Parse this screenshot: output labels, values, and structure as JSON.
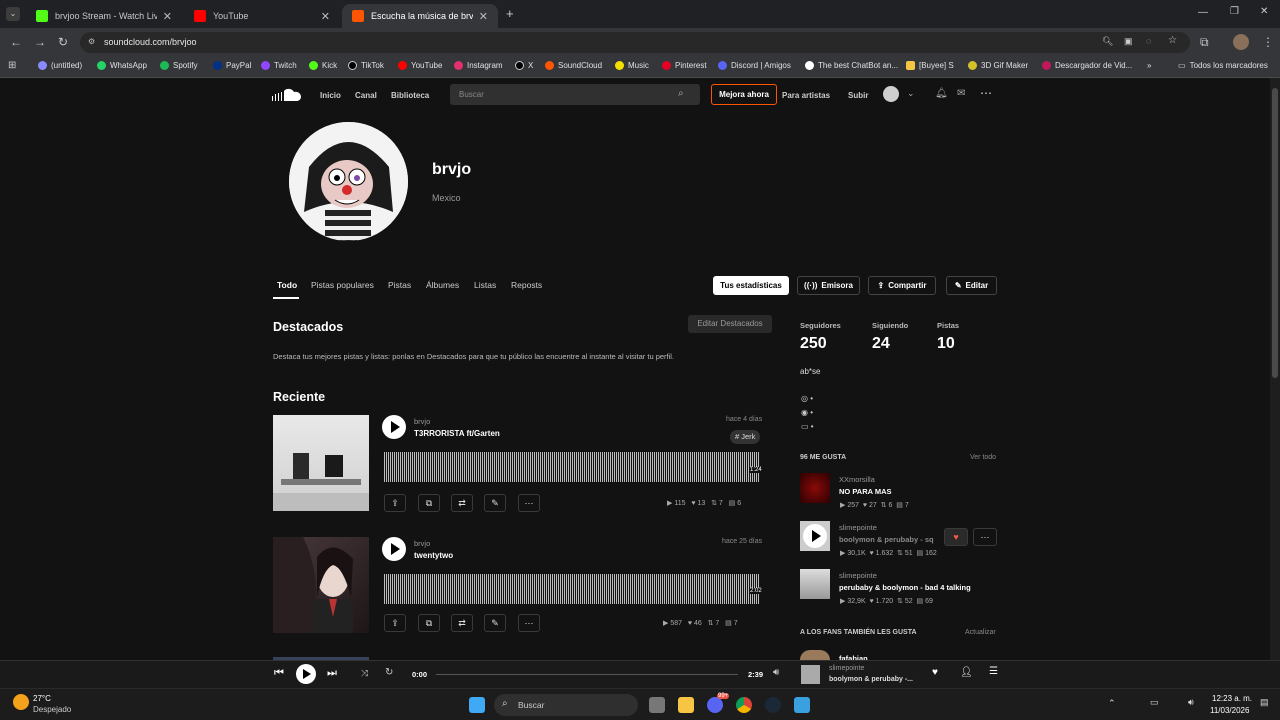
{
  "browser": {
    "tabs": [
      {
        "label": "brvjoo Stream - Watch Live on K"
      },
      {
        "label": "YouTube"
      },
      {
        "label": "Escucha la música de brvjo | Di"
      }
    ],
    "new_tab": "+",
    "url": "soundcloud.com/brvjoo",
    "bookmarks": [
      "(untitled)",
      "WhatsApp",
      "Spotify",
      "PayPal",
      "Twitch",
      "Kick",
      "TikTok",
      "YouTube",
      "Instagram",
      "X",
      "SoundCloud",
      "Music",
      "Pinterest",
      "Discord | Amigos",
      "The best ChatBot an...",
      "[Buyee] S",
      "3D Gif Maker",
      "Descargador de Vid..."
    ],
    "bookmarks_more": "»",
    "all_bookmarks": "Todos los marcadores"
  },
  "colors": {
    "accent": "#ff5500",
    "bg": "#121212",
    "heart": "#f15a4a"
  },
  "nav": {
    "home": "Inicio",
    "feed": "Canal",
    "library": "Biblioteca",
    "search_placeholder": "Buscar",
    "upgrade": "Mejora ahora",
    "artists": "Para artistas",
    "upload": "Subir"
  },
  "profile": {
    "name": "brvjo",
    "location": "Mexico"
  },
  "profile_tabs": [
    "Todo",
    "Pistas populares",
    "Pistas",
    "Álbumes",
    "Listas",
    "Reposts"
  ],
  "profile_actions": {
    "stats": "Tus estadísticas",
    "station": "Emisora",
    "share": "Compartir",
    "edit": "Editar"
  },
  "spotlight": {
    "title": "Destacados",
    "edit": "Editar Destacados",
    "desc": "Destaca tus mejores pistas y listas: ponlas en Destacados para que tu público las encuentre al instante al visitar tu perfil."
  },
  "recent": {
    "title": "Reciente"
  },
  "tracks": [
    {
      "artist": "brvjo",
      "title": "T3RRORISTA ft/Garten",
      "date": "hace 4 días",
      "tag": "# Jerk",
      "duration": "1:24",
      "plays": "115",
      "likes": "13",
      "reposts": "7",
      "comments": "6"
    },
    {
      "artist": "brvjo",
      "title": "twentytwo",
      "date": "hace 25 días",
      "tag": "",
      "duration": "2:02",
      "plays": "587",
      "likes": "46",
      "reposts": "7",
      "comments": "7"
    }
  ],
  "sidebar": {
    "followers_label": "Seguidores",
    "followers": "250",
    "following_label": "Siguiendo",
    "following": "24",
    "tracks_label": "Pistas",
    "tracks": "10",
    "bio": "ab*se",
    "social_links": [
      "•",
      "•",
      "•"
    ],
    "likes_header": "96 ME GUSTA",
    "see_all": "Ver todo",
    "likes": [
      {
        "artist": "XXmorsilla",
        "title": "NO PARA MAS",
        "plays": "257",
        "likes": "27",
        "reposts": "6",
        "comments": "7"
      },
      {
        "artist": "slimepointe",
        "title": "boolymon & perubaby - sq",
        "plays": "30,1K",
        "likes": "1.632",
        "reposts": "51",
        "comments": "162"
      },
      {
        "artist": "slimepointe",
        "title": "perubaby & boolymon - bad 4 talking",
        "plays": "32,9K",
        "likes": "1.720",
        "reposts": "52",
        "comments": "69"
      }
    ],
    "fans_header": "A LOS FANS TAMBIÉN LES GUSTA",
    "refresh": "Actualizar",
    "fan_partial": "fafabian"
  },
  "player": {
    "elapsed": "0:00",
    "total": "2:39",
    "artist": "slimepointe",
    "title": "boolymon & perubaby -...",
    "progress": 0.0
  },
  "taskbar": {
    "temp": "27°C",
    "weather": "Despejado",
    "search": "Buscar",
    "time": "12:23 a. m.",
    "date": "11/03/2026",
    "badge": "99+"
  }
}
